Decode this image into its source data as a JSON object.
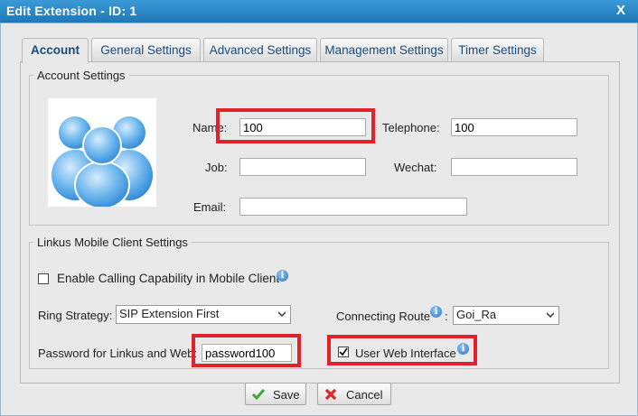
{
  "window": {
    "title": "Edit Extension - ID: 1",
    "close_label": "X"
  },
  "tabs": [
    {
      "label": "Account"
    },
    {
      "label": "General Settings"
    },
    {
      "label": "Advanced Settings"
    },
    {
      "label": "Management Settings"
    },
    {
      "label": "Timer Settings"
    }
  ],
  "account_settings": {
    "legend": "Account Settings",
    "name_label": "Name:",
    "name_value": "100",
    "telephone_label": "Telephone:",
    "telephone_value": "100",
    "job_label": "Job:",
    "job_value": "",
    "wechat_label": "Wechat:",
    "wechat_value": "",
    "email_label": "Email:",
    "email_value": ""
  },
  "linkus": {
    "legend": "Linkus Mobile Client Settings",
    "enable_calling_label": "Enable Calling Capability in Mobile Client",
    "enable_calling_checked": false,
    "ring_strategy_label": "Ring Strategy:",
    "ring_strategy_value": "SIP Extension First",
    "connecting_route_label": "Connecting Route",
    "connecting_route_colon": ":",
    "connecting_route_value": "Goi_Ra",
    "password_label": "Password for Linkus and Web:",
    "password_value": "password100",
    "user_web_label": "User Web Interface",
    "user_web_checked": true
  },
  "buttons": {
    "save": "Save",
    "cancel": "Cancel"
  },
  "colors": {
    "title_bar": "#2a88c8",
    "highlight": "#e1212b",
    "tab_text": "#1a4a7a"
  }
}
